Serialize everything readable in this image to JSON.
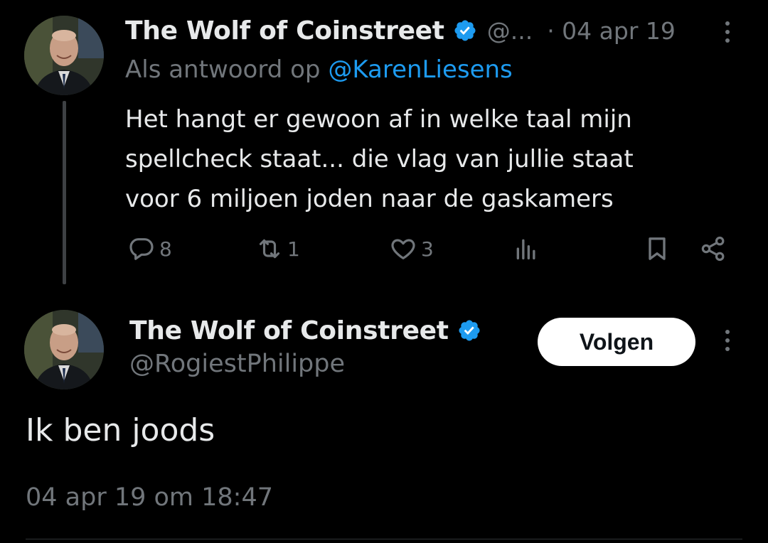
{
  "reply_tweet": {
    "author_name": "The Wolf of Coinstreet",
    "handle_truncated": "@...",
    "date": "· 04 apr 19",
    "reply_prefix": "Als antwoord op",
    "reply_to_handle": "@KarenLiesens",
    "text_lines": [
      "Het hangt er gewoon af in welke taal mijn",
      "spellcheck staat... die vlag van jullie staat",
      "voor 6 miljoen joden naar de gaskamers"
    ],
    "actions": {
      "replies": "8",
      "retweets": "1",
      "likes": "3"
    }
  },
  "main_tweet": {
    "author_name": "The Wolf of Coinstreet",
    "handle": "@RogiestPhilippe",
    "follow_label": "Volgen",
    "text": "Ik ben joods",
    "timestamp": "04 apr 19 om 18:47"
  },
  "colors": {
    "background": "#000000",
    "text_primary": "#e7e9ea",
    "text_muted": "#71767b",
    "link": "#1d9bf0",
    "verified_badge": "#1d9bf0",
    "follow_button_bg": "#ffffff"
  },
  "icons": {
    "verified": "verified-badge-icon",
    "more": "more-options-icon",
    "reply": "reply-icon",
    "retweet": "retweet-icon",
    "like": "heart-icon",
    "views": "views-icon",
    "bookmark": "bookmark-icon",
    "share": "share-icon"
  }
}
